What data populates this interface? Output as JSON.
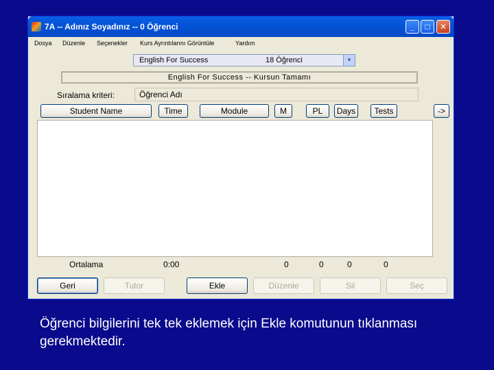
{
  "window": {
    "title": "7A -- Adınız Soyadınız -- 0 Öğrenci",
    "controls": {
      "minimize": "_",
      "maximize": "□",
      "close": "✕"
    }
  },
  "menu": [
    "Dosya",
    "Düzenle",
    "Seçenekler",
    "Kurs Ayrıntılarını Görüntüle",
    "Yardım"
  ],
  "course_select": {
    "name": "English For Success",
    "count": "18 Öğrenci"
  },
  "course_banner": "English For Success  --  Kursun Tamamı",
  "sort": {
    "label": "Sıralama kriteri:",
    "value": "Öğrenci Adı"
  },
  "columns": [
    "Student Name",
    "Time",
    "Module",
    "M",
    "PL",
    "Days",
    "Tests",
    "->"
  ],
  "averages": {
    "label": "Ortalama",
    "time": "0:00",
    "m": "0",
    "pl": "0",
    "days": "0",
    "tests": "0"
  },
  "actions": {
    "back": "Geri",
    "tutor": "Tutor",
    "add": "Ekle",
    "edit": "Düzenle",
    "delete": "Sil",
    "select": "Seç"
  },
  "caption": "Öğrenci bilgilerini tek tek eklemek için Ekle komutunun tıklanması  gerekmektedir.",
  "colors": {
    "background": "#0a0a8c",
    "titlebar": "#0454d8",
    "window": "#ece9d8"
  }
}
